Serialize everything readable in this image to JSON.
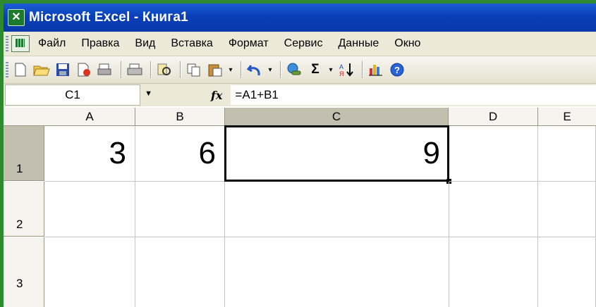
{
  "window": {
    "title": "Microsoft Excel - Книга1",
    "app_icon": "excel-icon"
  },
  "menu": [
    "Файл",
    "Правка",
    "Вид",
    "Вставка",
    "Формат",
    "Сервис",
    "Данные",
    "Окно"
  ],
  "toolbar": {
    "icons": [
      "new-icon",
      "open-icon",
      "save-icon",
      "permission-icon",
      "print-preview-icon",
      "print-icon",
      "research-icon",
      "copy-icon",
      "paste-icon",
      "undo-icon",
      "hyperlink-icon",
      "autosum-icon",
      "sort-ascending-icon",
      "chart-wizard-icon",
      "help-icon"
    ],
    "autosum_symbol": "Σ"
  },
  "formula_bar": {
    "name_box": "C1",
    "fx_label": "fx",
    "formula": "=A1+B1"
  },
  "sheet": {
    "columns": [
      "A",
      "B",
      "C",
      "D",
      "E"
    ],
    "rows": [
      "1",
      "2",
      "3"
    ],
    "cells": {
      "A1": "3",
      "B1": "6",
      "C1": "9"
    },
    "active_cell": "C1"
  },
  "colors": {
    "title_bar": "#0a3fb8",
    "frame": "#2f8a2f",
    "chrome": "#ece9d8"
  }
}
